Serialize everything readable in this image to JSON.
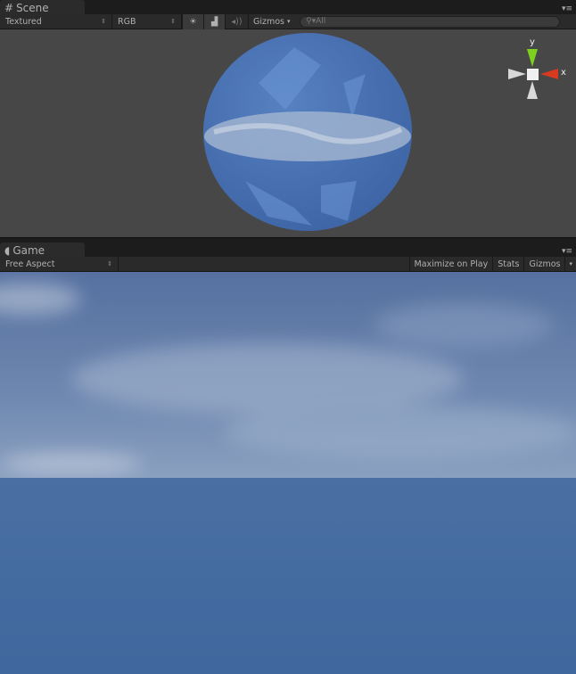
{
  "scene": {
    "tab_label": "Scene",
    "render_mode": "Textured",
    "color_mode": "RGB",
    "gizmos_label": "Gizmos",
    "search_placeholder": "All",
    "gizmo": {
      "y_label": "y",
      "x_label": "x",
      "x_color": "#d83a1e",
      "y_color": "#7ed020"
    }
  },
  "game": {
    "tab_label": "Game",
    "aspect": "Free Aspect",
    "maximize_label": "Maximize on Play",
    "stats_label": "Stats",
    "gizmos_label": "Gizmos"
  },
  "colors": {
    "scene_bg": "#474747",
    "sphere": "#4a78c0",
    "sky": "#5a74a0",
    "sea": "#41699e"
  }
}
